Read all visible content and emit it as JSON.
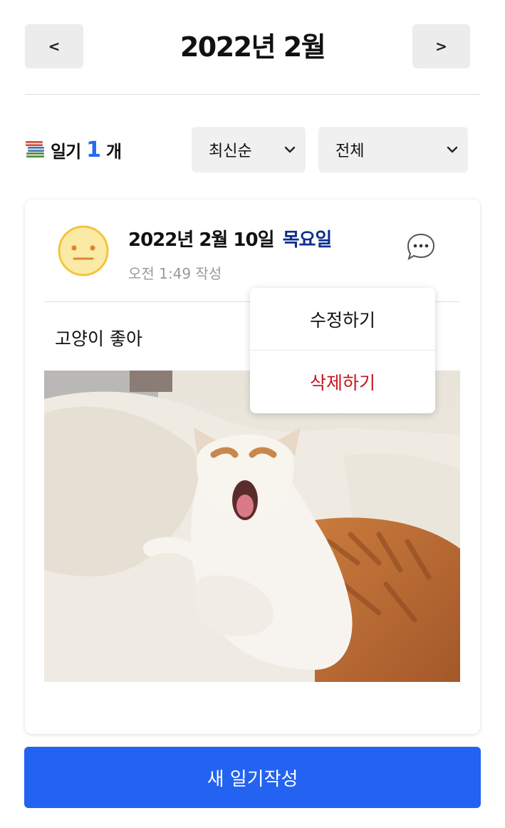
{
  "header": {
    "prev_label": "<",
    "next_label": ">",
    "month_title": "2022년 2월"
  },
  "summary": {
    "icon": "books-icon",
    "prefix": "일기",
    "count": "1",
    "suffix": "개"
  },
  "filters": {
    "sort_selected": "최신순",
    "category_selected": "전체"
  },
  "entry": {
    "mood_icon": "neutral-face-icon",
    "date": "2022년 2월 10일",
    "weekday": "목요일",
    "time": "오전 1:49 작성",
    "text": "고양이 좋아",
    "photo": "cat-yawning-on-bed",
    "more_icon": "more-options-icon"
  },
  "menu": {
    "edit_label": "수정하기",
    "delete_label": "삭제하기"
  },
  "footer": {
    "new_entry_label": "새 일기작성"
  },
  "colors": {
    "accent": "#2463f2",
    "count": "#2669f0",
    "weekday": "#0d2e8a",
    "delete": "#c5161d",
    "mood_face": "#fbe9a6"
  }
}
